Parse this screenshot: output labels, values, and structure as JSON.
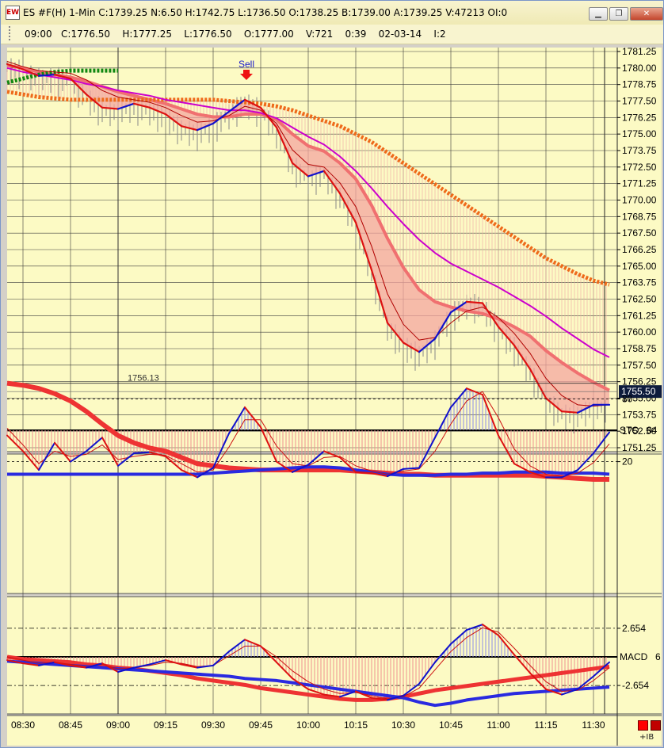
{
  "window": {
    "title": "ES #F(H) 1-Min C:1739.25 N:6.50 H:1742.75 L:1736.50 O:1738.25 B:1739.00 A:1739.25 V:47213 OI:0",
    "icon_label": "EW",
    "minimize_label": "▁",
    "restore_label": "❐",
    "close_label": "✕"
  },
  "infobar": {
    "text": "09:00   C:1776.50    H:1777.25    L:1776.50    O:1777.00    V:721    0:39    02-03-14    I:2"
  },
  "colors": {
    "background": "#fcfac4",
    "grid": "#3a3a3a",
    "price_down": "#dd1111",
    "price_up": "#1111cc",
    "ribbon_fill": "#f4a6a0",
    "ribbon_edge": "#f07070",
    "magenta_ma": "#cc00cc",
    "orange_ma": "#ee6a1a",
    "green_ma": "#118811",
    "hist_pos": "#8c8ce8",
    "hist_neg": "#f09090"
  },
  "chart_data": [
    {
      "type": "line",
      "panel": "price",
      "instrument": "ES #F(H)",
      "interval": "1-Min",
      "x": [
        "08:25",
        "08:30",
        "08:35",
        "08:40",
        "08:45",
        "08:50",
        "08:55",
        "09:00",
        "09:05",
        "09:10",
        "09:15",
        "09:20",
        "09:25",
        "09:30",
        "09:35",
        "09:38",
        "09:40",
        "09:45",
        "09:50",
        "09:55",
        "10:00",
        "10:05",
        "10:10",
        "10:15",
        "10:20",
        "10:25",
        "10:30",
        "10:35",
        "10:40",
        "10:45",
        "10:50",
        "10:55",
        "11:00",
        "11:05",
        "11:10",
        "11:15",
        "11:20",
        "11:25",
        "11:30"
      ],
      "ylim": [
        1751.25,
        1781.25
      ],
      "yticks": [
        "1751.25",
        "1752.50",
        "1753.75",
        "1755.00",
        "1756.25",
        "1757.50",
        "1758.75",
        "1760.00",
        "1761.25",
        "1762.50",
        "1763.75",
        "1765.00",
        "1766.25",
        "1767.50",
        "1768.75",
        "1770.00",
        "1771.25",
        "1772.50",
        "1773.75",
        "1775.00",
        "1776.25",
        "1777.50",
        "1778.75",
        "1780.00",
        "1781.25"
      ],
      "xticks": [
        "08:30",
        "08:45",
        "09:00",
        "09:15",
        "09:30",
        "09:45",
        "10:00",
        "10:15",
        "10:30",
        "10:45",
        "11:00",
        "11:15",
        "11:30"
      ],
      "series": [
        {
          "values": [
            1780.3,
            1779.9,
            1779.4,
            1779.5,
            1779.2,
            1778.0,
            1777.0,
            1776.9,
            1777.3,
            1777.0,
            1776.5,
            1775.6,
            1775.3,
            1775.8,
            1776.7,
            1777.6,
            1777.0,
            1775.5,
            1772.8,
            1771.8,
            1772.2,
            1770.5,
            1768.3,
            1764.7,
            1760.7,
            1759.2,
            1758.5,
            1759.5,
            1761.5,
            1762.3,
            1762.2,
            1760.4,
            1759.0,
            1757.2,
            1755.0,
            1754.0,
            1753.9,
            1754.5,
            1754.5
          ]
        },
        {
          "values": [
            1780.5,
            1780.1,
            1779.8,
            1779.7,
            1779.6,
            1779.1,
            1778.3,
            1777.8,
            1777.6,
            1777.4,
            1777.0,
            1776.4,
            1775.9,
            1776.0,
            1776.4,
            1777.1,
            1776.8,
            1775.8,
            1773.8,
            1772.7,
            1772.5,
            1771.3,
            1769.5,
            1766.5,
            1762.9,
            1760.6,
            1759.4,
            1759.6,
            1760.7,
            1761.6,
            1761.9,
            1761.1,
            1759.9,
            1758.4,
            1756.5,
            1755.2,
            1754.5,
            1754.4,
            1754.5
          ]
        },
        {
          "values": [
            1780.2,
            1780.0,
            1779.7,
            1779.5,
            1779.3,
            1779.0,
            1778.6,
            1778.2,
            1777.9,
            1777.6,
            1777.3,
            1776.9,
            1776.5,
            1776.3,
            1776.3,
            1776.5,
            1776.5,
            1776.1,
            1775.0,
            1774.1,
            1773.7,
            1772.8,
            1771.6,
            1769.6,
            1767.1,
            1764.9,
            1763.2,
            1762.3,
            1761.9,
            1761.6,
            1761.4,
            1761.0,
            1760.4,
            1759.7,
            1758.6,
            1757.7,
            1756.9,
            1756.2,
            1755.6
          ]
        },
        {
          "values": [
            1780.0,
            1779.7,
            1779.5,
            1779.3,
            1779.1,
            1778.8,
            1778.6,
            1778.3,
            1778.1,
            1777.9,
            1777.6,
            1777.4,
            1777.2,
            1777.0,
            1776.8,
            1776.8,
            1776.6,
            1776.2,
            1775.5,
            1774.8,
            1774.2,
            1773.3,
            1772.2,
            1770.9,
            1769.5,
            1768.2,
            1767.0,
            1766.0,
            1765.2,
            1764.6,
            1764.0,
            1763.4,
            1762.7,
            1762.0,
            1761.2,
            1760.3,
            1759.5,
            1758.7,
            1758.1
          ]
        },
        {
          "values": [
            1778.2,
            1778.0,
            1777.8,
            1777.7,
            1777.6,
            1777.6,
            1777.6,
            1777.6,
            1777.6,
            1777.6,
            1777.6,
            1777.6,
            1777.6,
            1777.6,
            1777.5,
            1777.4,
            1777.3,
            1777.1,
            1776.8,
            1776.4,
            1776.0,
            1775.6,
            1775.0,
            1774.4,
            1773.6,
            1772.8,
            1772.0,
            1771.2,
            1770.4,
            1769.6,
            1768.8,
            1768.0,
            1767.2,
            1766.4,
            1765.6,
            1765.0,
            1764.4,
            1763.9,
            1763.6
          ]
        },
        {
          "values": [
            1778.9,
            1779.2,
            1779.5,
            1779.7,
            1779.8,
            1779.8,
            1779.8,
            1779.8
          ]
        }
      ],
      "annotations": {
        "signal_label": "Sell",
        "ref_line_label": "1756.13",
        "ref_line_value": 1756.13,
        "last_price": "1755.50",
        "last_price_value": 1755.5
      }
    },
    {
      "type": "line",
      "panel": "stochastic",
      "label": "STO",
      "label_value": "84",
      "ylim": [
        0,
        100
      ],
      "yticks": [
        "80",
        "20"
      ],
      "midline": 50,
      "series": [
        {
          "values": [
            45,
            30,
            12,
            38,
            20,
            30,
            43,
            16,
            28,
            29,
            25,
            12,
            5,
            14,
            47,
            72,
            53,
            20,
            10,
            17,
            30,
            24,
            10,
            9,
            6,
            13,
            14,
            43,
            72,
            90,
            84,
            45,
            18,
            10,
            5,
            5,
            12,
            28,
            48
          ]
        },
        {
          "values": [
            52,
            36,
            18,
            30,
            25,
            27,
            36,
            22,
            25,
            27,
            26,
            18,
            10,
            12,
            34,
            60,
            60,
            35,
            18,
            16,
            24,
            25,
            16,
            11,
            8,
            11,
            13,
            30,
            56,
            78,
            87,
            62,
            32,
            16,
            8,
            6,
            9,
            19,
            37
          ]
        },
        {
          "values": [
            95,
            93,
            90,
            85,
            78,
            68,
            56,
            45,
            38,
            33,
            30,
            24,
            18,
            16,
            14,
            13,
            12,
            12,
            12,
            12,
            12,
            12,
            11,
            10,
            9,
            8,
            8,
            7,
            7,
            7,
            7,
            7,
            7,
            7,
            6,
            5,
            4,
            3,
            3
          ]
        },
        {
          "values": [
            8,
            8,
            8,
            8,
            8,
            8,
            8,
            8,
            8,
            8,
            8,
            8,
            8,
            9,
            10,
            11,
            12,
            13,
            14,
            15,
            15,
            14,
            12,
            10,
            8,
            7,
            7,
            7,
            8,
            8,
            9,
            9,
            10,
            10,
            10,
            9,
            9,
            9,
            8
          ]
        }
      ]
    },
    {
      "type": "line",
      "panel": "macd",
      "label": "MACD",
      "label_value": "6",
      "ylim": [
        -4.5,
        4.0
      ],
      "yticks": [
        "2.654",
        "-2.654"
      ],
      "levels": [
        2.654,
        -2.654
      ],
      "series": [
        {
          "values": [
            -0.3,
            -0.6,
            -0.8,
            -0.5,
            -0.8,
            -1.0,
            -0.6,
            -1.4,
            -1.0,
            -0.7,
            -0.3,
            -0.7,
            -1.0,
            -0.8,
            0.5,
            1.6,
            1.0,
            -0.5,
            -2.0,
            -3.0,
            -3.5,
            -3.7,
            -3.2,
            -3.8,
            -4.0,
            -3.6,
            -2.5,
            -0.5,
            1.2,
            2.5,
            3.0,
            2.0,
            0.2,
            -1.5,
            -3.0,
            -3.5,
            -3.0,
            -1.8,
            -0.5
          ]
        },
        {
          "values": [
            0.0,
            -0.3,
            -0.6,
            -0.5,
            -0.7,
            -0.9,
            -0.7,
            -1.1,
            -1.0,
            -0.8,
            -0.5,
            -0.6,
            -0.9,
            -0.8,
            0.1,
            1.0,
            1.0,
            0.0,
            -1.3,
            -2.3,
            -3.0,
            -3.4,
            -3.3,
            -3.6,
            -3.9,
            -3.7,
            -2.9,
            -1.2,
            0.5,
            1.8,
            2.7,
            2.3,
            0.8,
            -0.8,
            -2.3,
            -3.2,
            -3.1,
            -2.2,
            -1.0
          ]
        },
        {
          "values": [
            0.0,
            -0.2,
            -0.3,
            -0.4,
            -0.5,
            -0.7,
            -0.8,
            -1.0,
            -1.1,
            -1.3,
            -1.5,
            -1.7,
            -2.0,
            -2.2,
            -2.4,
            -2.6,
            -2.9,
            -3.1,
            -3.3,
            -3.5,
            -3.7,
            -3.9,
            -4.0,
            -4.0,
            -3.9,
            -3.7,
            -3.4,
            -3.1,
            -2.9,
            -2.7,
            -2.5,
            -2.3,
            -2.1,
            -1.9,
            -1.7,
            -1.5,
            -1.3,
            -1.1,
            -0.9
          ]
        },
        {
          "values": [
            -0.4,
            -0.5,
            -0.6,
            -0.7,
            -0.8,
            -0.9,
            -1.0,
            -1.1,
            -1.2,
            -1.3,
            -1.4,
            -1.5,
            -1.6,
            -1.7,
            -1.8,
            -2.0,
            -2.1,
            -2.2,
            -2.4,
            -2.6,
            -2.8,
            -3.0,
            -3.2,
            -3.4,
            -3.6,
            -3.8,
            -4.2,
            -4.5,
            -4.3,
            -4.0,
            -3.8,
            -3.6,
            -3.4,
            -3.3,
            -3.2,
            -3.1,
            -3.0,
            -2.9,
            -2.8
          ]
        }
      ]
    }
  ]
}
